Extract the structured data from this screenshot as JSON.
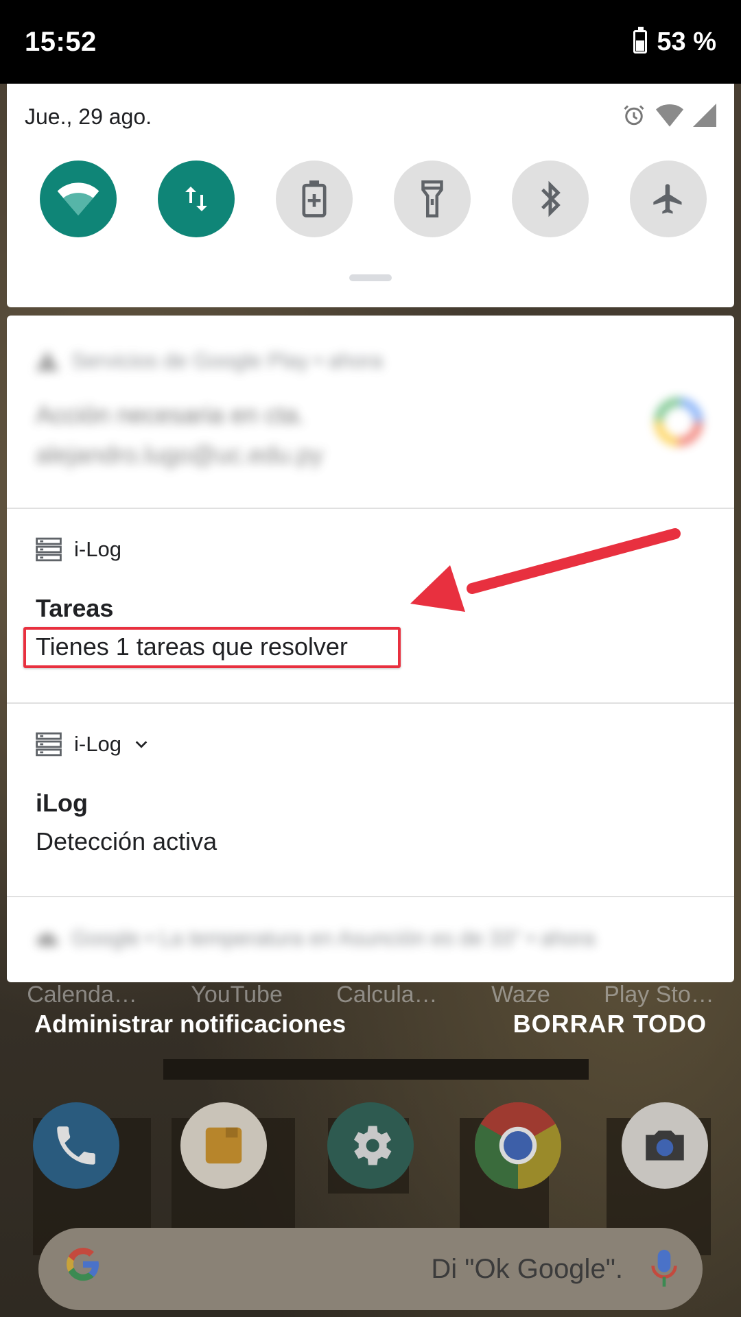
{
  "status_bar": {
    "time": "15:52",
    "battery": "53 %"
  },
  "quick_settings": {
    "date": "Jue., 29 ago.",
    "tiles": [
      {
        "name": "wifi",
        "icon": "wifi-icon",
        "active": true
      },
      {
        "name": "mobile-data",
        "icon": "data-arrows-icon",
        "active": true
      },
      {
        "name": "battery-saver",
        "icon": "battery-saver-icon",
        "active": false
      },
      {
        "name": "flashlight",
        "icon": "flashlight-icon",
        "active": false
      },
      {
        "name": "bluetooth",
        "icon": "bluetooth-icon",
        "active": false
      },
      {
        "name": "airplane-mode",
        "icon": "airplane-icon",
        "active": false
      }
    ],
    "colors": {
      "active_tile": "#0f8577",
      "inactive_tile": "#e0e0e0"
    }
  },
  "notifications": {
    "blurred_top": {
      "header": "Servicios de Google Play • ahora",
      "title": "Acción necesaria en cta.",
      "text": "alejandro.lugo@uc.edu.py"
    },
    "ilog_tasks": {
      "app": "i-Log",
      "title": "Tareas",
      "text": "Tienes 1 tareas que resolver"
    },
    "ilog_detection": {
      "app": "i-Log",
      "title": "iLog",
      "text": "Detección activa"
    },
    "blurred_bottom": {
      "header": "Google • La temperatura en Asunción es de 33° • ahora"
    }
  },
  "shade_actions": {
    "manage": "Administrar notificaciones",
    "clear_all": "BORRAR TODO"
  },
  "home": {
    "app_labels": [
      "Calenda…",
      "YouTube",
      "Calcula…",
      "Waze",
      "Play Sto…"
    ],
    "search_hint": "Di \"Ok Google\"."
  },
  "annotation": {
    "color": "#e8303f"
  }
}
